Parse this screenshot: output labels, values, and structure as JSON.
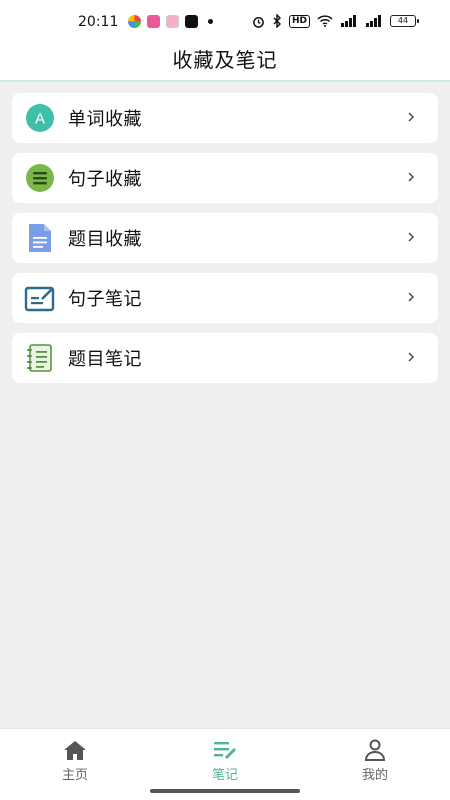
{
  "status_bar": {
    "time": "20:11",
    "right_text": "HD",
    "battery": "44"
  },
  "header": {
    "title": "收藏及笔记"
  },
  "list": [
    {
      "label": "单词收藏",
      "icon": "letter-a-icon"
    },
    {
      "label": "句子收藏",
      "icon": "lines-circle-icon"
    },
    {
      "label": "题目收藏",
      "icon": "document-icon"
    },
    {
      "label": "句子笔记",
      "icon": "edit-note-icon"
    },
    {
      "label": "题目笔记",
      "icon": "notebook-icon"
    }
  ],
  "list_icon_letter": "A",
  "nav": [
    {
      "label": "主页",
      "icon": "home-icon"
    },
    {
      "label": "笔记",
      "icon": "notes-pen-icon",
      "active": true
    },
    {
      "label": "我的",
      "icon": "person-icon"
    }
  ],
  "colors": {
    "accent": "#52b39b",
    "background": "#efefef",
    "teal_icon": "#3fbfa8",
    "green_icon": "#7ab648",
    "blue_icon": "#7b9ee8",
    "navy_icon": "#2e6b8f"
  }
}
